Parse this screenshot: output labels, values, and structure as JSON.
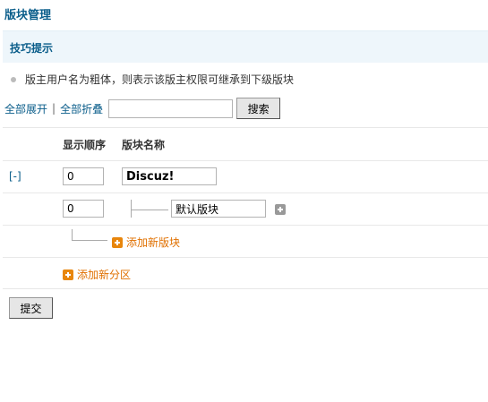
{
  "page": {
    "title": "版块管理"
  },
  "tips": {
    "title": "技巧提示",
    "items": [
      "版主用户名为粗体，则表示该版主权限可继承到下级版块"
    ]
  },
  "toolbar": {
    "expand_all": "全部展开",
    "separator": "|",
    "collapse_all": "全部折叠",
    "search_value": "",
    "search_button": "搜索"
  },
  "table": {
    "headers": {
      "order": "显示顺序",
      "name": "版块名称"
    }
  },
  "categories": [
    {
      "toggle": "[-]",
      "order": "0",
      "name": "Discuz!",
      "forums": [
        {
          "order": "0",
          "name": "默认版块"
        }
      ],
      "add_forum_label": "添加新版块"
    }
  ],
  "add_category_label": "添加新分区",
  "submit_label": "提交",
  "icons": {
    "add_subforum": "plus-square-gray-icon",
    "add": "plus-square-orange-icon"
  },
  "colors": {
    "link": "#0a5d8a",
    "add_link": "#e07000",
    "tips_bg": "#eef6fb"
  }
}
